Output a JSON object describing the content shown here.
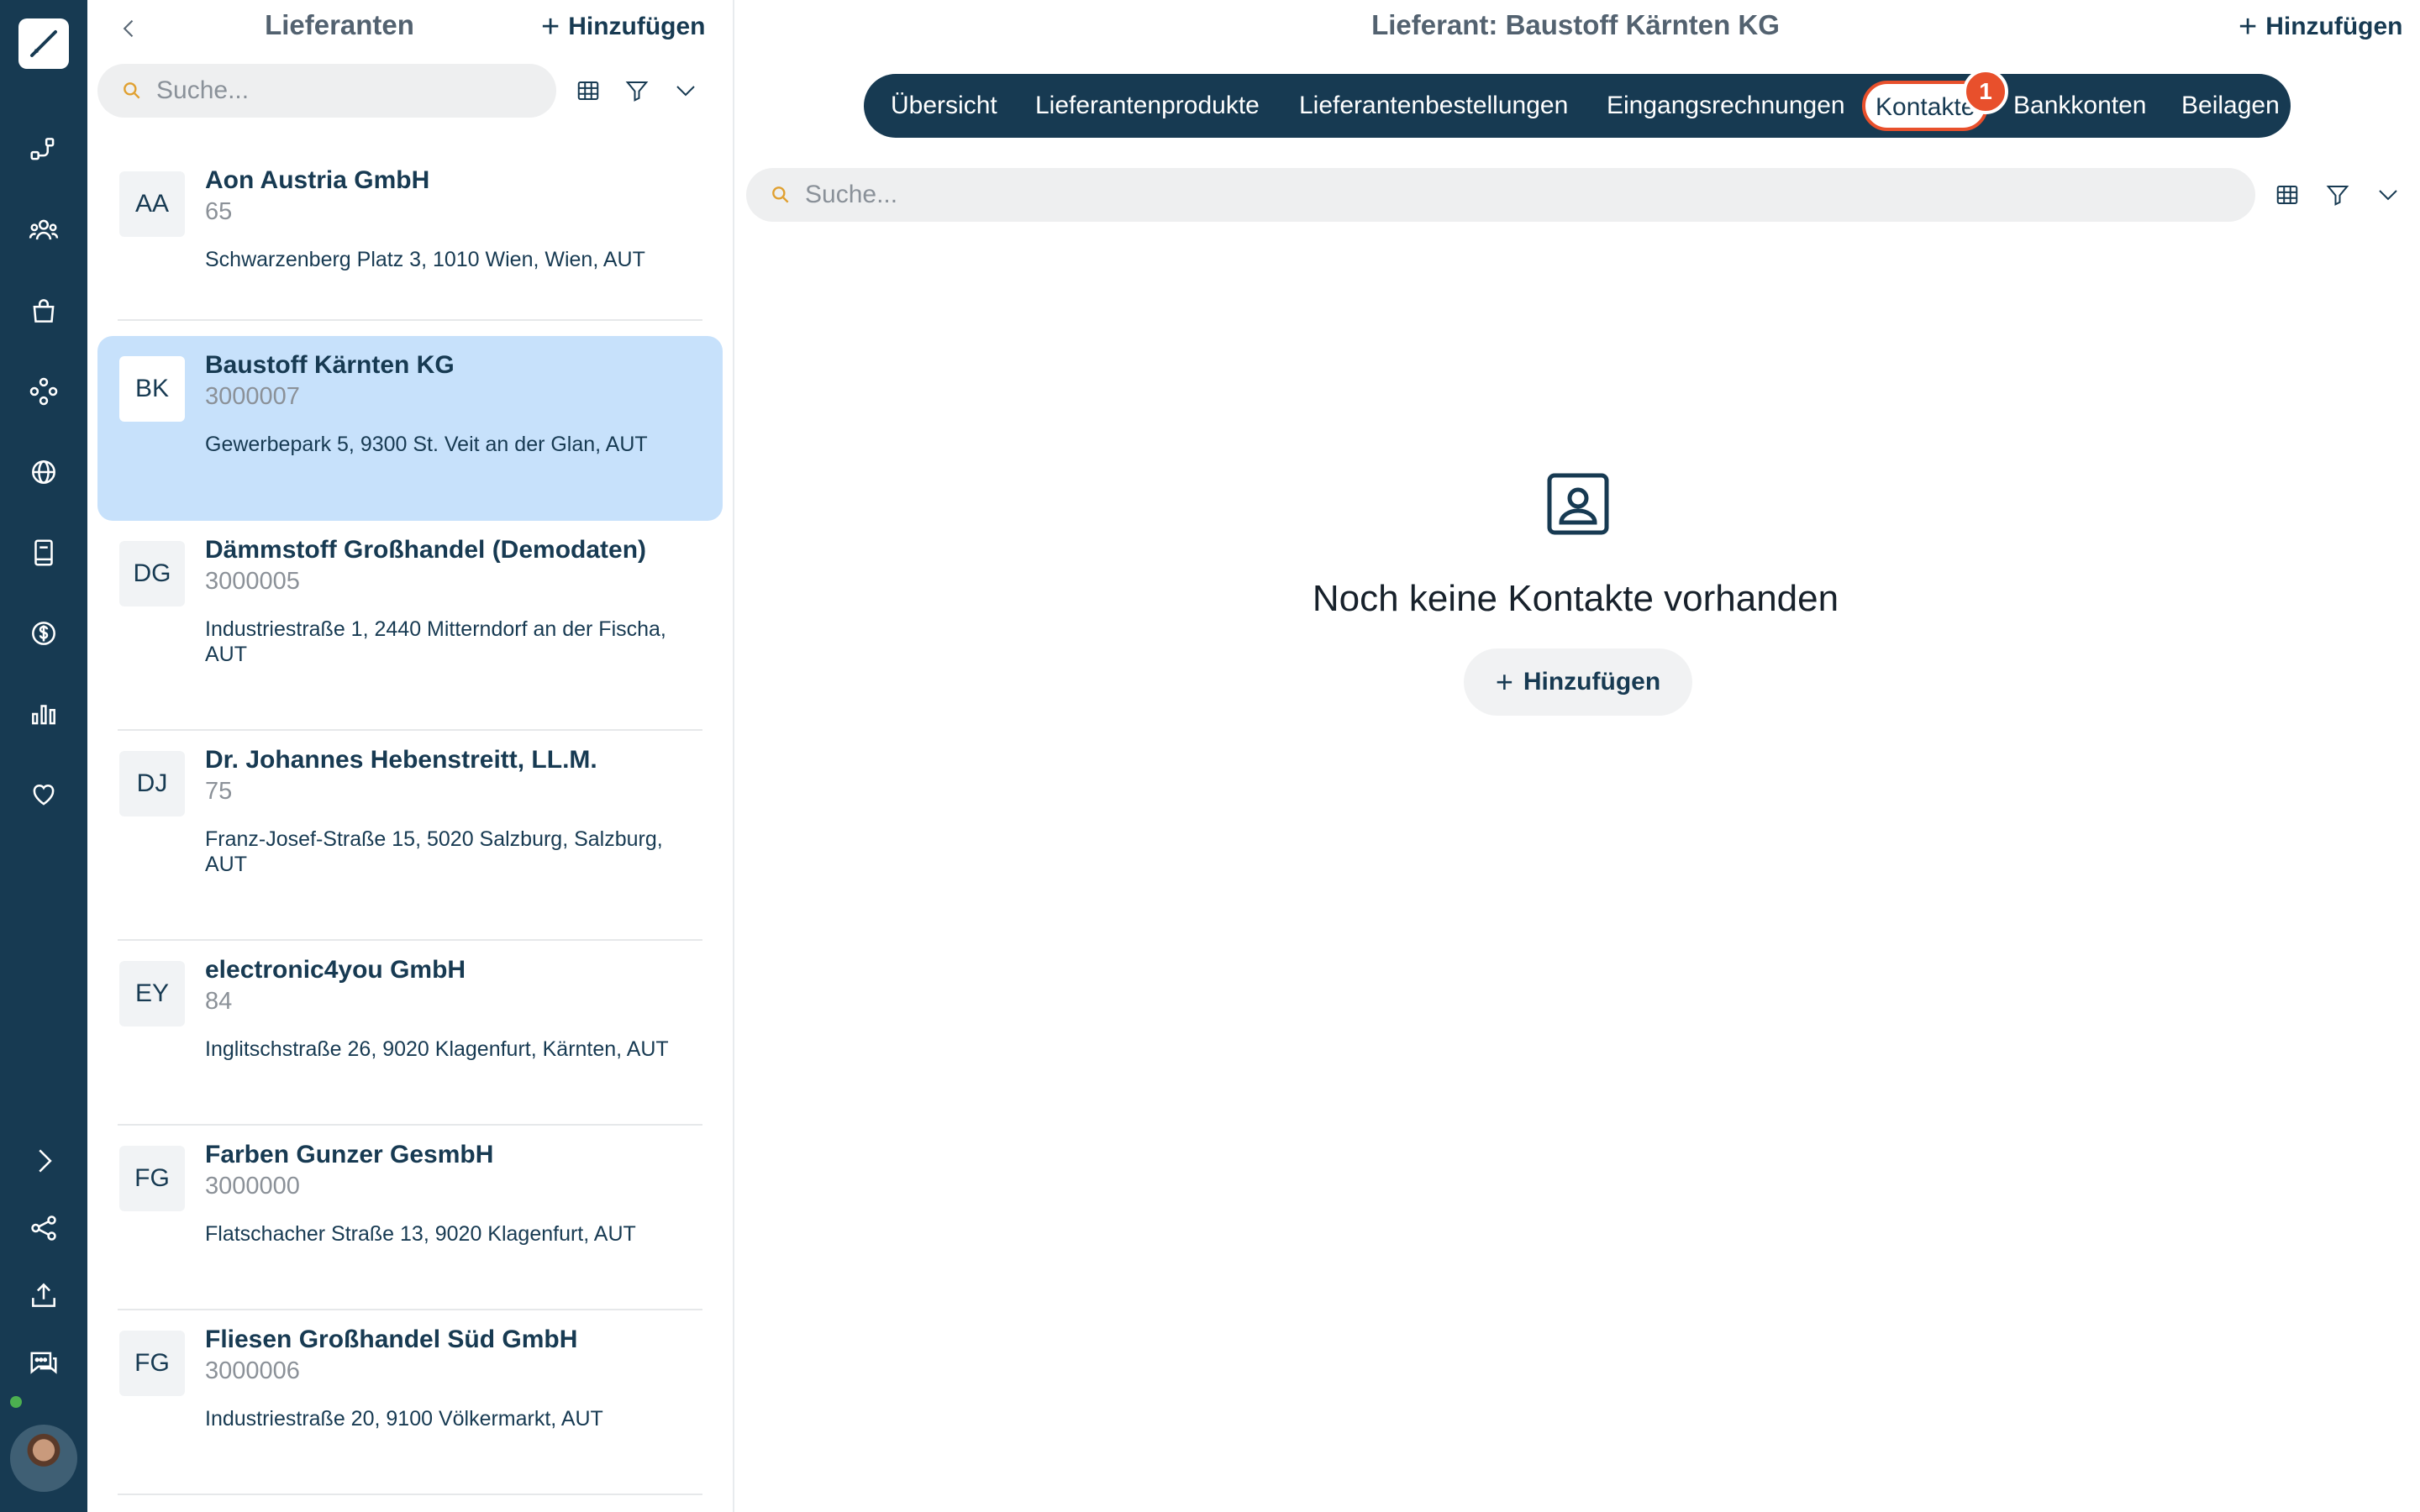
{
  "rail": {
    "icons": [
      "logo-icon",
      "workflow-icon",
      "users-icon",
      "shopping-bag-icon",
      "network-icon",
      "globe-icon",
      "book-icon",
      "dollar-icon",
      "bar-chart-icon",
      "heart-icon",
      "chevron-right-icon",
      "share-icon",
      "upload-icon",
      "chat-icon"
    ],
    "status_color": "#4caf50"
  },
  "list": {
    "title": "Lieferanten",
    "add_label": "Hinzufügen",
    "search_placeholder": "Suche...",
    "items": [
      {
        "initials": "AA",
        "name": "Aon Austria GmbH",
        "number": "65",
        "address": "Schwarzenberg Platz 3, 1010 Wien, Wien, AUT"
      },
      {
        "initials": "BK",
        "name": "Baustoff Kärnten KG",
        "number": "3000007",
        "address": "Gewerbepark 5, 9300 St. Veit an der Glan, AUT"
      },
      {
        "initials": "DG",
        "name": "Dämmstoff Großhandel (Demodaten)",
        "number": "3000005",
        "address": "Industriestraße 1, 2440 Mitterndorf an der Fischa, AUT"
      },
      {
        "initials": "DJ",
        "name": "Dr. Johannes Hebenstreitt, LL.M.",
        "number": "75",
        "address": "Franz-Josef-Straße 15, 5020 Salzburg, Salzburg, AUT"
      },
      {
        "initials": "EY",
        "name": "electronic4you GmbH",
        "number": "84",
        "address": "Inglitschstraße 26, 9020 Klagenfurt, Kärnten, AUT"
      },
      {
        "initials": "FG",
        "name": "Farben Gunzer GesmbH",
        "number": "3000000",
        "address": "Flatschacher Straße 13, 9020 Klagenfurt, AUT"
      },
      {
        "initials": "FG",
        "name": "Fliesen Großhandel Süd GmbH",
        "number": "3000006",
        "address": "Industriestraße 20, 9100 Völkermarkt, AUT"
      }
    ],
    "selected_index": 1
  },
  "detail": {
    "title": "Lieferant: Baustoff Kärnten KG",
    "add_label": "Hinzufügen",
    "tabs": [
      "Übersicht",
      "Lieferantenprodukte",
      "Lieferantenbestellungen",
      "Eingangsrechnungen",
      "Kontakte",
      "Bankkonten",
      "Beilagen"
    ],
    "active_tab": "Kontakte",
    "badge": "1",
    "search_placeholder": "Suche...",
    "empty_text": "Noch keine Kontakte vorhanden",
    "empty_add_label": "Hinzufügen"
  },
  "colors": {
    "navy": "#173a52",
    "selected": "#c7e1fb",
    "highlight": "#e8502c",
    "search_icon": "#e0a030"
  }
}
